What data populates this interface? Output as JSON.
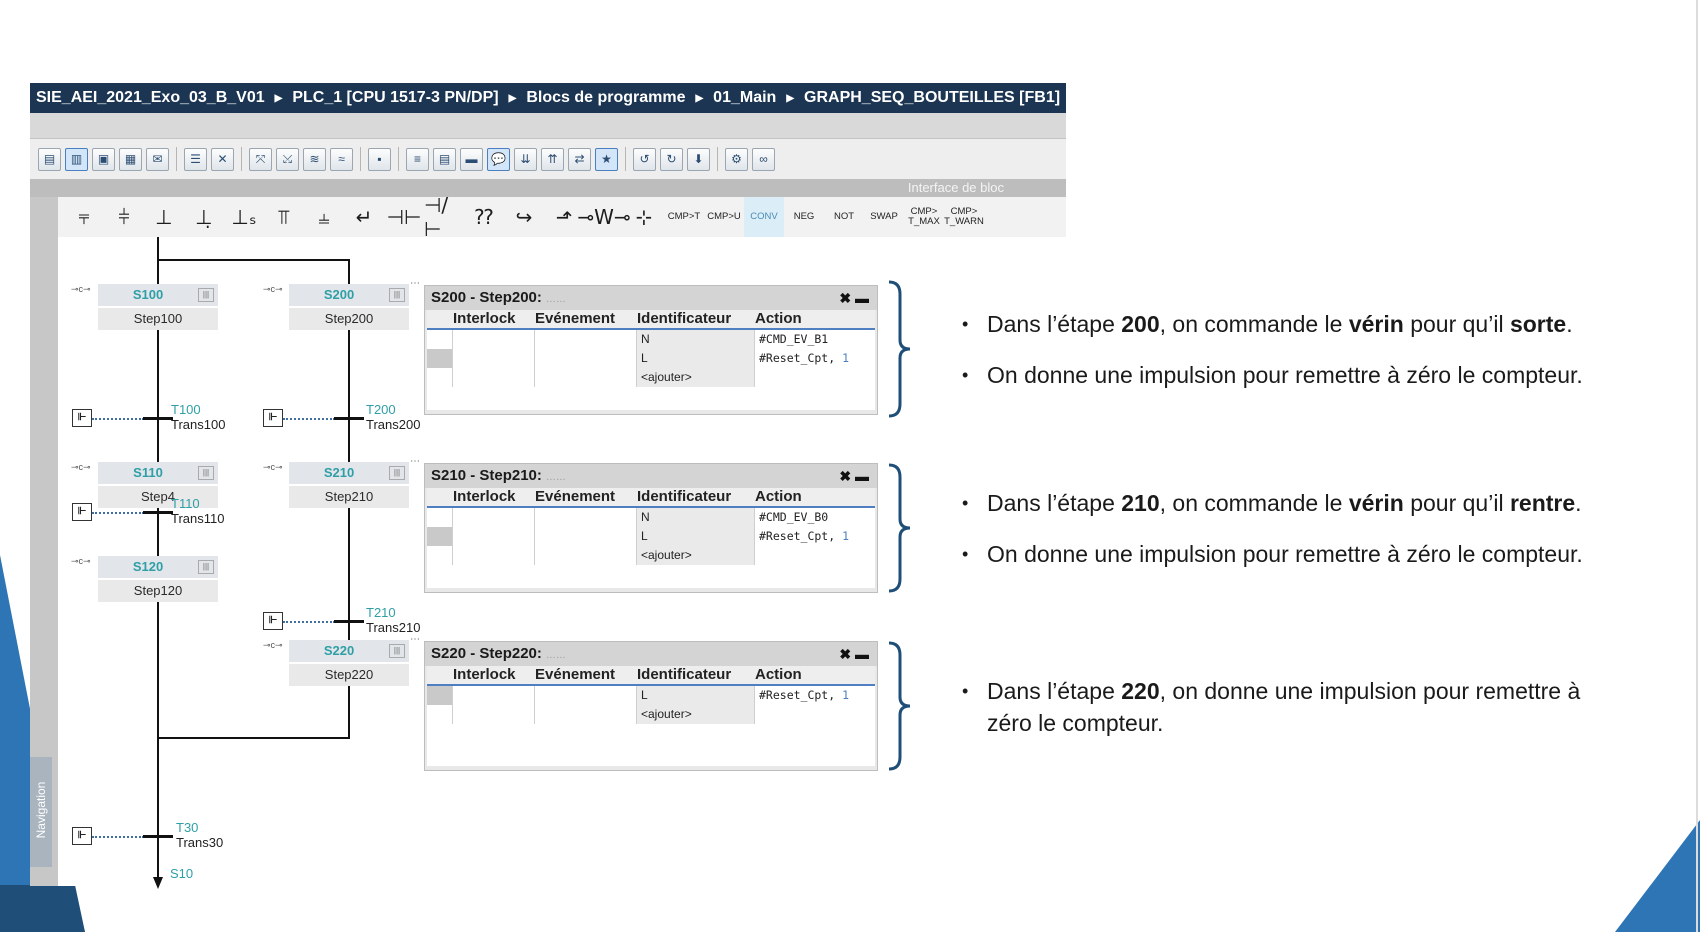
{
  "breadcrumb": [
    "SIE_AEI_2021_Exo_03_B_V01",
    "PLC_1 [CPU 1517-3 PN/DP]",
    "Blocs de programme",
    "01_Main",
    "GRAPH_SEQ_BOUTEILLES [FB1]"
  ],
  "interface_label": "Interface de bloc",
  "navigation_label": "Navigation",
  "toolbar1_icons": [
    "view-icon",
    "sequence-view-icon",
    "single-step-icon",
    "permanent-ops-icon",
    "alarm-view-icon",
    "insert-step-icon",
    "delete-step-icon",
    "zoom-icon",
    "zoom-out-icon",
    "fit-icon",
    "fit-all-icon",
    "monitor-icon",
    "list-icon",
    "table-icon",
    "bar-icon",
    "comment-icon",
    "expand-icon",
    "collapse-icon",
    "jump-icon",
    "favorite-icon",
    "call-icon",
    "goto-icon",
    "download-icon",
    "settings-icon",
    "infinity-icon"
  ],
  "toolbar2": {
    "symbols": [
      "⫧",
      "⫩",
      "⊥",
      "⊥̣",
      "⊥ₛ",
      "⫪",
      "⫨",
      "↵",
      "⊣⊢",
      "⊣/⊢",
      "⁇",
      "↪",
      "⬏",
      "⊸W⊸",
      "⊹"
    ],
    "text_buttons": [
      "CMP>T",
      "CMP>U",
      "CONV",
      "NEG",
      "NOT",
      "SWAP",
      "CMP> T_MAX",
      "CMP> T_WARN"
    ]
  },
  "steps": {
    "s100": {
      "num": "S100",
      "name": "Step100"
    },
    "s110": {
      "num": "S110",
      "name": "Step4"
    },
    "s120": {
      "num": "S120",
      "name": "Step120"
    },
    "s200": {
      "num": "S200",
      "name": "Step200"
    },
    "s210": {
      "num": "S210",
      "name": "Step210"
    },
    "s220": {
      "num": "S220",
      "name": "Step220"
    },
    "s10": {
      "num": "S10"
    }
  },
  "transitions": {
    "t100": {
      "num": "T100",
      "name": "Trans100"
    },
    "t110": {
      "num": "T110",
      "name": "Trans110"
    },
    "t200": {
      "num": "T200",
      "name": "Trans200"
    },
    "t210": {
      "num": "T210",
      "name": "Trans210"
    },
    "t30": {
      "num": "T30",
      "name": "Trans30"
    }
  },
  "action_table_headers": {
    "interlock": "Interlock",
    "event": "Evénement",
    "identifier": "Identificateur",
    "action": "Action"
  },
  "panels": {
    "p200": {
      "title": "S200 - Step200:",
      "rows": [
        {
          "q": "N",
          "action": "#CMD_EV_B1",
          "n": ""
        },
        {
          "q": "L",
          "action": "#Reset_Cpt, ",
          "n": "1"
        },
        {
          "q": "<ajouter>",
          "action": "",
          "n": ""
        }
      ]
    },
    "p210": {
      "title": "S210 - Step210:",
      "rows": [
        {
          "q": "N",
          "action": "#CMD_EV_B0",
          "n": ""
        },
        {
          "q": "L",
          "action": "#Reset_Cpt, ",
          "n": "1"
        },
        {
          "q": "<ajouter>",
          "action": "",
          "n": ""
        }
      ]
    },
    "p220": {
      "title": "S220 - Step220:",
      "rows": [
        {
          "q": "L",
          "action": "#Reset_Cpt, ",
          "n": "1"
        },
        {
          "q": "<ajouter>",
          "action": "",
          "n": ""
        }
      ]
    }
  },
  "notes": {
    "n200": {
      "b1_pre": "Dans l’étape ",
      "b1_num": "200",
      "b1_mid": ", on commande le ",
      "b1_v": "vérin",
      "b1_mid2": " pour qu’il ",
      "b1_end": "sorte",
      "b1_dot": ".",
      "b2": "On donne une impulsion pour remettre à zéro le compteur."
    },
    "n210": {
      "b1_pre": "Dans l’étape ",
      "b1_num": "210",
      "b1_mid": ", on commande le ",
      "b1_v": "vérin",
      "b1_mid2": " pour qu’il ",
      "b1_end": "rentre",
      "b1_dot": ".",
      "b2": "On donne une impulsion pour remettre à zéro le compteur."
    },
    "n220": {
      "pre": "Dans l’étape ",
      "num": "220",
      "line1_rest": ", on donne une impulsion pour remettre à",
      "line2": "zéro le compteur."
    }
  },
  "colors": {
    "breadcrumb_bg": "#1b3552",
    "step_number": "#2f9fa7",
    "brace": "#1f4e79",
    "deco_blue": "#2e75b6"
  }
}
